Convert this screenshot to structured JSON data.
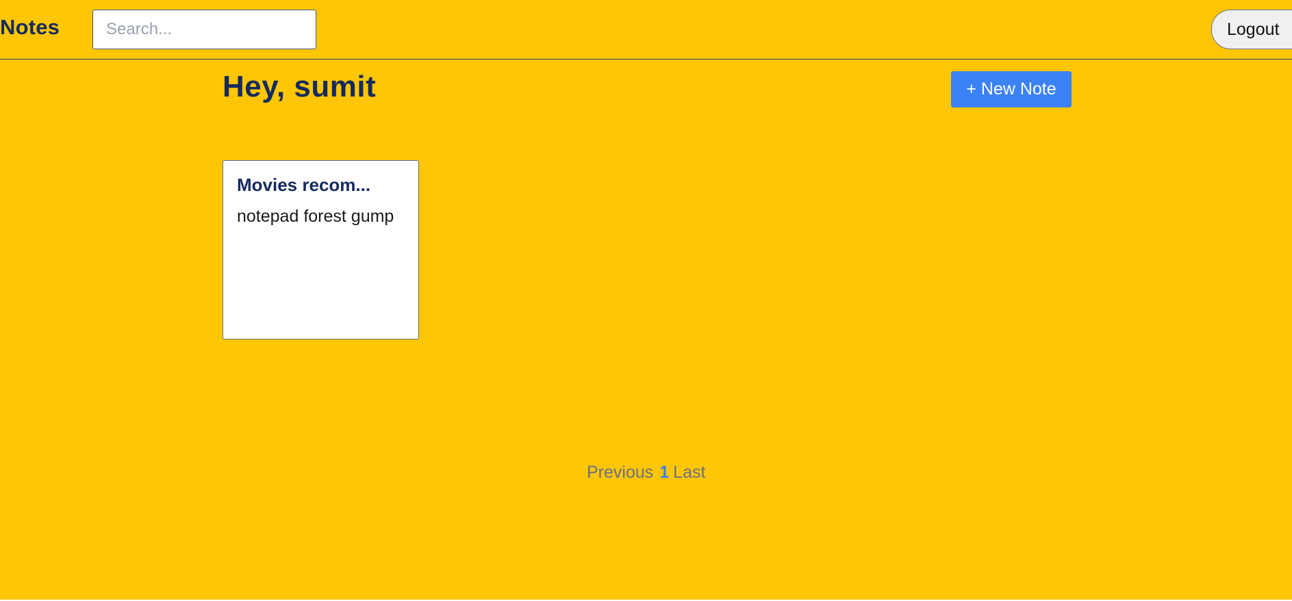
{
  "navbar": {
    "brand": "Notes",
    "search": {
      "placeholder": "Search...",
      "value": ""
    },
    "logout_label": "Logout"
  },
  "header": {
    "greeting": "Hey, sumit",
    "new_note_label": "+ New Note"
  },
  "notes": [
    {
      "title": "Movies recom...",
      "body": "notepad forest gump"
    }
  ],
  "pagination": {
    "previous_label": "Previous",
    "current_page": "1",
    "last_label": "Last"
  },
  "colors": {
    "background": "#ffc605",
    "primary_text": "#152a5e",
    "accent": "#3b82f6",
    "muted_link": "#6b6f80"
  }
}
